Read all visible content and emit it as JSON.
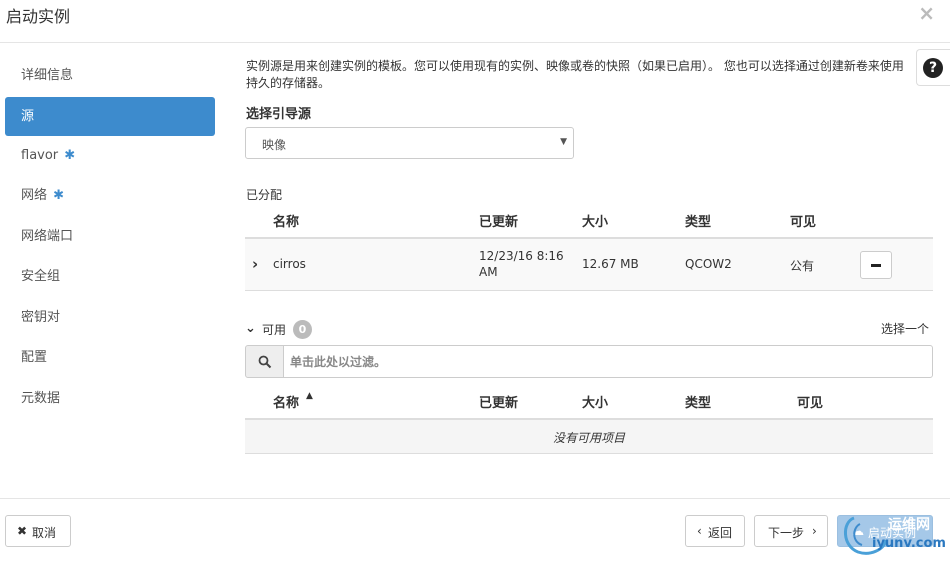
{
  "modal": {
    "title": "启动实例",
    "close_icon": "×"
  },
  "sidebar": {
    "items": [
      {
        "label": "详细信息",
        "required": false,
        "active": false
      },
      {
        "label": "源",
        "required": false,
        "active": true
      },
      {
        "label": "flavor",
        "required": true,
        "active": false
      },
      {
        "label": "网络",
        "required": true,
        "active": false
      },
      {
        "label": "网络端口",
        "required": false,
        "active": false
      },
      {
        "label": "安全组",
        "required": false,
        "active": false
      },
      {
        "label": "密钥对",
        "required": false,
        "active": false
      },
      {
        "label": "配置",
        "required": false,
        "active": false
      },
      {
        "label": "元数据",
        "required": false,
        "active": false
      }
    ],
    "required_mark": "✱"
  },
  "help": {
    "icon": "?"
  },
  "main": {
    "description": "实例源是用来创建实例的模板。您可以使用现有的实例、映像或卷的快照（如果已启用）。 您也可以选择通过创建新卷来使用持久的存储器。",
    "boot_source_label": "选择引导源",
    "boot_source_value": "映像",
    "allocated_label": "已分配",
    "columns": {
      "name": "名称",
      "updated": "已更新",
      "size": "大小",
      "type": "类型",
      "visibility": "可见"
    },
    "allocated_rows": [
      {
        "name": "cirros",
        "updated": "12/23/16 8:16 AM",
        "size": "12.67 MB",
        "type": "QCOW2",
        "visibility": "公有"
      }
    ],
    "available_label": "可用",
    "available_count": "0",
    "select_one": "选择一个",
    "filter_placeholder": "单击此处以过滤。",
    "empty_text": "没有可用项目"
  },
  "footer": {
    "cancel": "取消",
    "back": "返回",
    "next": "下一步",
    "launch": "启动实例"
  },
  "watermark": {
    "text1": "运维网",
    "text2": "iyunv.com"
  },
  "colors": {
    "accent": "#3d8bcd",
    "primary_disabled": "#a5c8e8"
  }
}
